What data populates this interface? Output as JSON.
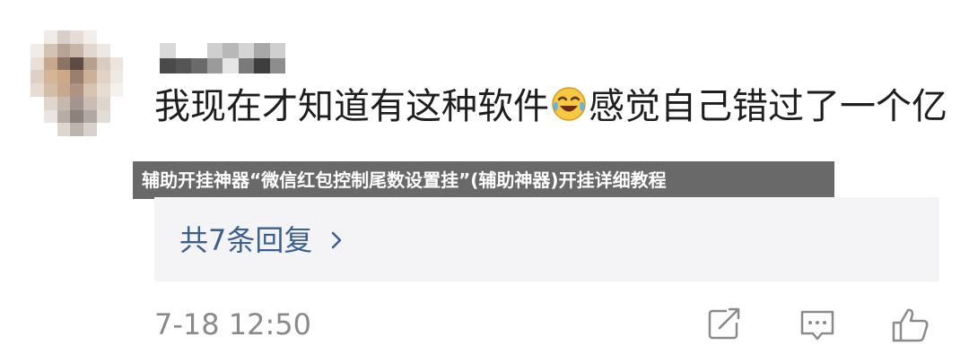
{
  "comment": {
    "text_before_emoji": "我现在才知道有这种软件",
    "emoji": "laughing-crying-emoji",
    "text_after_emoji": "感觉自己错过了一个亿"
  },
  "banner": {
    "text": "辅助开挂神器“微信红包控制尾数设置挂”(辅助神器)开挂详细教程"
  },
  "replies": {
    "label": "共7条回复",
    "icon": "chevron-right-icon"
  },
  "meta": {
    "timestamp": "7-18 12:50"
  },
  "actions": {
    "icons": [
      "share-edit-icon",
      "comment-icon",
      "like-icon"
    ]
  },
  "colors": {
    "link": "#3b5f8f",
    "text": "#1e1e1e",
    "muted": "#8a8a8a",
    "reply_bg": "#f4f4f6",
    "banner_bg": "#484848"
  }
}
